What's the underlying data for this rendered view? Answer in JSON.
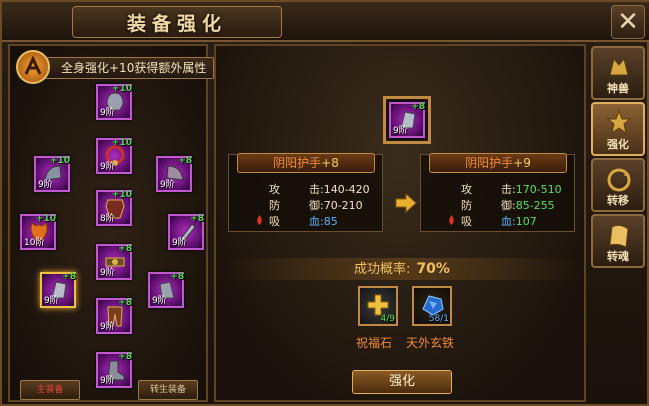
{
  "window": {
    "title": "装备强化",
    "close_icon": "close-icon"
  },
  "set_bonus": {
    "label": "全身强化+10获得额外属性",
    "icon": "set-bonus-icon"
  },
  "slots": [
    {
      "id": "helmet",
      "tier": "9阶",
      "plus": "+10",
      "icon": "helmet-icon"
    },
    {
      "id": "necklace",
      "tier": "9阶",
      "plus": "+10",
      "icon": "necklace-icon"
    },
    {
      "id": "shoulder-left",
      "tier": "9阶",
      "plus": "+10",
      "icon": "shoulder-icon"
    },
    {
      "id": "shoulder-right",
      "tier": "9阶",
      "plus": "+8",
      "icon": "shoulder-icon"
    },
    {
      "id": "armor",
      "tier": "8阶",
      "plus": "+10",
      "icon": "armor-icon"
    },
    {
      "id": "wing",
      "tier": "10阶",
      "plus": "+10",
      "icon": "wing-icon"
    },
    {
      "id": "offhand",
      "tier": "9阶",
      "plus": "+8",
      "icon": "offhand-icon"
    },
    {
      "id": "belt",
      "tier": "9阶",
      "plus": "+8",
      "icon": "belt-icon"
    },
    {
      "id": "glove-left",
      "tier": "9阶",
      "plus": "+8",
      "icon": "glove-icon"
    },
    {
      "id": "glove-right",
      "tier": "9阶",
      "plus": "+8",
      "icon": "glove-icon"
    },
    {
      "id": "pants",
      "tier": "9阶",
      "plus": "+8",
      "icon": "pants-icon"
    },
    {
      "id": "boots",
      "tier": "9阶",
      "plus": "+8",
      "icon": "boots-icon"
    }
  ],
  "bottom_tabs": [
    "主装备",
    "转生装备"
  ],
  "selected_item": {
    "tier": "9阶",
    "plus": "+8"
  },
  "current": {
    "name": "阴阳护手",
    "plus": "+8",
    "attack_label": "攻",
    "attack_value": "击:140-420",
    "defense_label": "防",
    "defense_value": "御:70-210",
    "absorb_label": "吸",
    "absorb_value": "血:85"
  },
  "next": {
    "name": "阴阳护手",
    "plus": "+9",
    "attack_label": "攻",
    "attack_prefix": "击:",
    "attack_value": "170-510",
    "defense_label": "防",
    "defense_prefix": "御:",
    "defense_value": "85-255",
    "absorb_label": "吸",
    "absorb_prefix": "血:",
    "absorb_value": "107"
  },
  "success_rate": {
    "label": "成功概率:",
    "value": "70%"
  },
  "materials": [
    {
      "name": "祝福石",
      "count": "4/9",
      "icon": "blessing-stone-icon"
    },
    {
      "name": "天外玄铁",
      "count": "58/1",
      "icon": "meteor-iron-icon"
    }
  ],
  "enhance_button": "强化",
  "side_tabs": [
    {
      "label": "神兽",
      "icon": "beast-icon",
      "active": false
    },
    {
      "label": "强化",
      "icon": "enhance-icon",
      "active": true
    },
    {
      "label": "转移",
      "icon": "transfer-icon",
      "active": false
    },
    {
      "label": "转魂",
      "icon": "soul-icon",
      "active": false
    }
  ],
  "colors": {
    "accent_gold": "#f0c060",
    "rarity_purple": "#b02cc0",
    "upgrade_green": "#58e050",
    "blood_blue": "#5ab0ff",
    "item_name_orange": "#f08a3a"
  }
}
